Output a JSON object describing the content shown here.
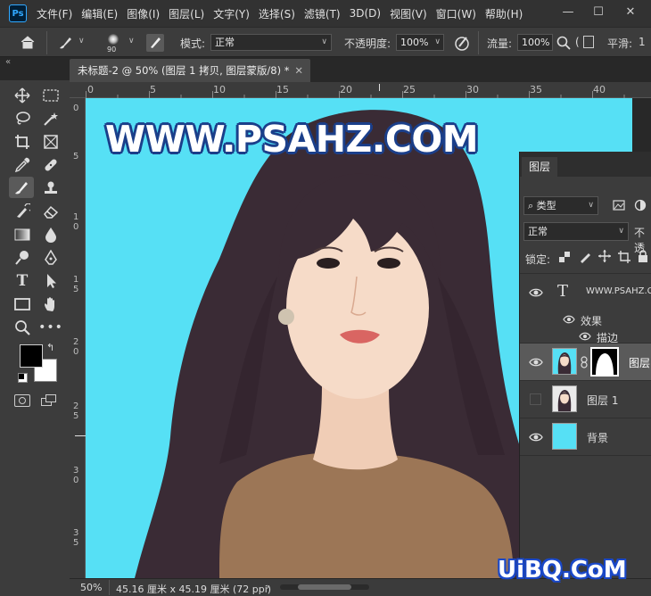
{
  "app": {
    "logo_text": "Ps",
    "menu": [
      "文件(F)",
      "编辑(E)",
      "图像(I)",
      "图层(L)",
      "文字(Y)",
      "选择(S)",
      "滤镜(T)",
      "3D(D)",
      "视图(V)",
      "窗口(W)",
      "帮助(H)"
    ]
  },
  "options_bar": {
    "brush_size": "90",
    "mode_label": "模式:",
    "mode_value": "正常",
    "opacity_label": "不透明度:",
    "opacity_value": "100%",
    "flow_label": "流量:",
    "flow_value": "100%",
    "smoothing_label": "平滑:",
    "smoothing_value": "1"
  },
  "document": {
    "tab_title": "未标题-2 @ 50% (图层 1 拷贝, 图层蒙版/8) *",
    "canvas_text": "WWW.PSAHZ.COM",
    "bg_color": "#56e0f5"
  },
  "rulers": {
    "h_ticks": [
      "0",
      "5",
      "10",
      "15",
      "20",
      "25",
      "30",
      "35",
      "40"
    ],
    "v_ticks": [
      [
        "0"
      ],
      [
        "5"
      ],
      [
        "1",
        "0"
      ],
      [
        "1",
        "5"
      ],
      [
        "2",
        "0"
      ],
      [
        "2",
        "5"
      ],
      [
        "3",
        "0"
      ],
      [
        "3",
        "5"
      ]
    ]
  },
  "status": {
    "zoom": "50%",
    "doc_size": "45.16 厘米 x 45.19 厘米 (72 ppi)",
    "arrow": "›"
  },
  "layers_panel": {
    "tab_label": "图层",
    "filter_label": "类型",
    "blend_mode": "正常",
    "opacity_cut": "不透",
    "lock_label": "锁定:",
    "layers": [
      {
        "name": "WWW.PSAHZ.C",
        "kind": "text",
        "visible": true
      },
      {
        "name": "效果",
        "kind": "effects",
        "visible": true
      },
      {
        "name": "描边",
        "kind": "effect",
        "visible": true
      },
      {
        "name": "图层",
        "kind": "masked",
        "visible": true,
        "selected": true
      },
      {
        "name": "图层 1",
        "kind": "image",
        "visible": false
      },
      {
        "name": "背景",
        "kind": "fill",
        "visible": true,
        "color": "#56e0f5"
      }
    ]
  },
  "watermark": "UiBQ.CoM"
}
